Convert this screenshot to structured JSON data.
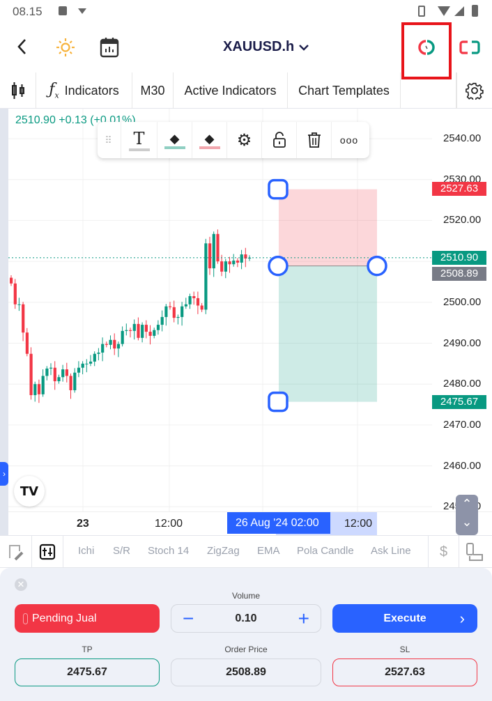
{
  "status_bar": {
    "time": "08.15"
  },
  "header": {
    "symbol": "XAUUSD.h"
  },
  "toolbar": {
    "indicators": "Indicators",
    "timeframe": "M30",
    "active_indicators": "Active Indicators",
    "chart_templates": "Chart Templates"
  },
  "chart": {
    "quote": "2510.90  +0.13 (+0.01%)",
    "axis_ticks": [
      "2540.00",
      "2530.00",
      "2520.00",
      "2510.00",
      "2500.00",
      "2490.00",
      "2480.00",
      "2470.00",
      "2460.00",
      "2450.00"
    ],
    "time_labels": {
      "day": "23",
      "t1": "12:00",
      "cursor": "26 Aug '24   02:00",
      "t2": "12:00"
    },
    "price_labels": {
      "sl": "2527.63",
      "last": "2510.90",
      "entry": "2508.89",
      "tp": "2475.67"
    },
    "colors": {
      "up": "#089981",
      "down": "#f23645",
      "accent": "#2962ff"
    }
  },
  "chart_data": {
    "type": "candlestick",
    "y_range": [
      2450,
      2545
    ],
    "first_open": 2506,
    "closes": [
      2504.6,
      2499.5,
      2499.5,
      2492.6,
      2487.4,
      2477.3,
      2480,
      2477.5,
      2482,
      2483.8,
      2484,
      2480.7,
      2481.7,
      2483.6,
      2482,
      2478.5,
      2482.8,
      2484,
      2485,
      2485,
      2485.5,
      2487.4,
      2487.7,
      2489.8,
      2489.6,
      2490.8,
      2488.7,
      2489.8,
      2493,
      2493.2,
      2493,
      2494.7,
      2491.3,
      2494.5,
      2492.8,
      2491.8,
      2493.2,
      2494.5,
      2496.4,
      2499,
      2498.8,
      2496.2,
      2496.4,
      2499,
      2499.5,
      2501.5,
      2501,
      2499.2,
      2498.2,
      2514.4,
      2508.3,
      2516.7,
      2510,
      2507.5,
      2510,
      2509.3,
      2510.2,
      2509.7,
      2511.7,
      2510.7,
      2510.9
    ],
    "last_price": 2510.9,
    "position": {
      "stop_loss": 2527.63,
      "entry": 2508.89,
      "take_profit": 2475.67
    }
  },
  "float_toolbar": {
    "icons": [
      "drag-handle-icon",
      "text-icon",
      "fill-green-icon",
      "fill-red-icon",
      "gear-icon",
      "unlock-icon",
      "trash-icon",
      "more-icon"
    ]
  },
  "indicator_bar": {
    "items": [
      "Ichi",
      "S/R",
      "Stoch 14",
      "ZigZag",
      "EMA",
      "Pola Candle",
      "Ask Line"
    ]
  },
  "order_panel": {
    "side_label": "Pending Jual",
    "volume_label": "Volume",
    "volume": "0.10",
    "execute_label": "Execute",
    "tp_label": "TP",
    "tp": "2475.67",
    "price_label": "Order Price",
    "price": "2508.89",
    "sl_label": "SL",
    "sl": "2527.63"
  }
}
